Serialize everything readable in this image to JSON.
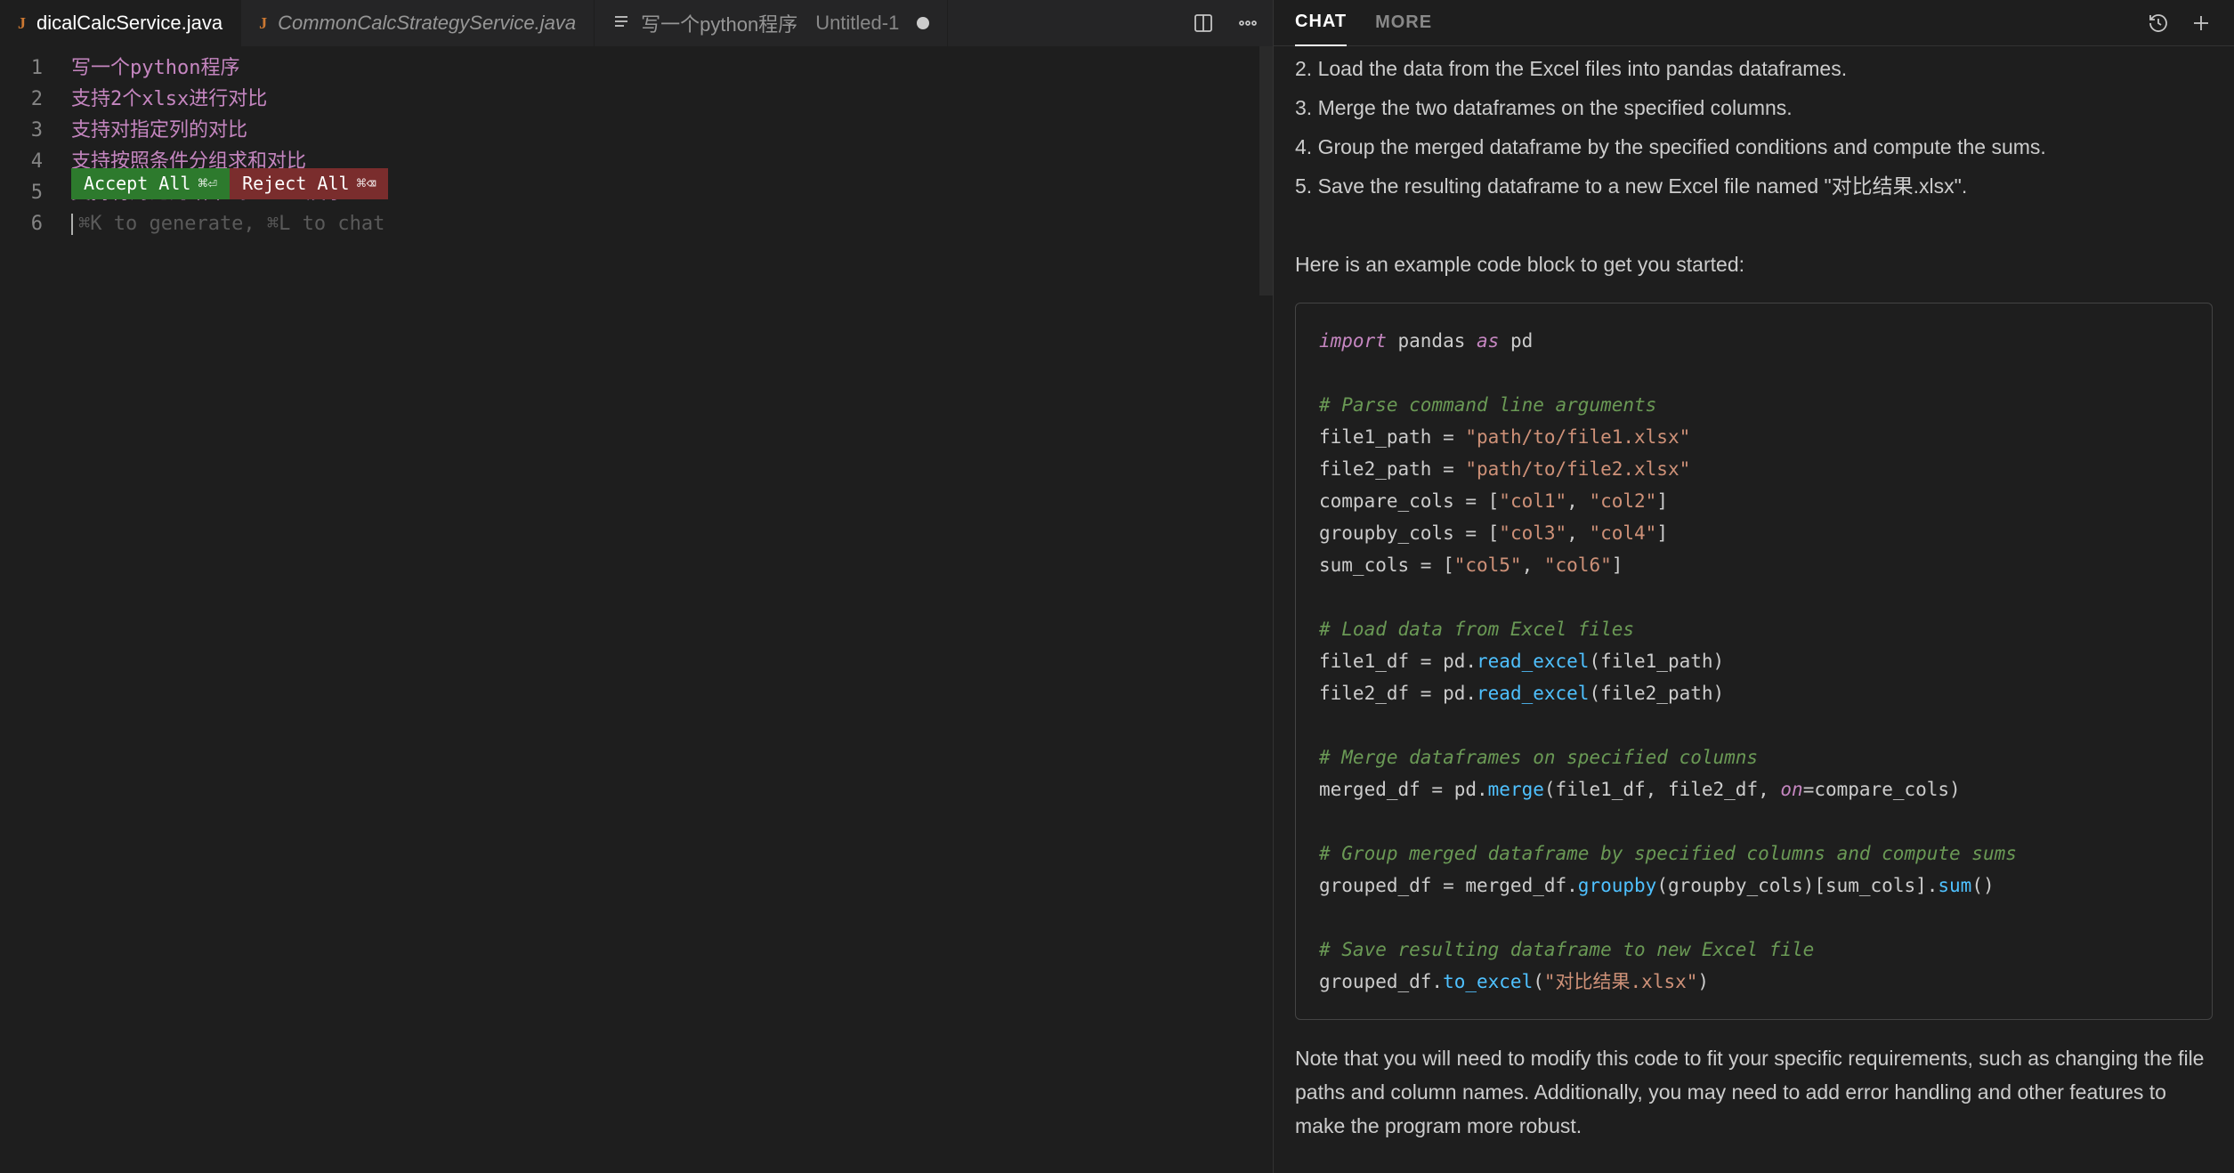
{
  "tabs": [
    {
      "icon": "J",
      "name": "dicalCalcService.java",
      "active": true
    },
    {
      "icon": "J",
      "name": "CommonCalcStrategyService.java",
      "italic": true
    },
    {
      "icon": "≡",
      "name": "写一个python程序",
      "untitled": "Untitled-1",
      "dirty": true
    }
  ],
  "editor": {
    "lines": [
      "写一个python程序",
      "支持2个xlsx进行对比",
      "支持对指定列的对比",
      "支持按照条件分组求和对比",
      "支持将对比的结果到excel展示"
    ],
    "hint": "⌘K to generate, ⌘L to chat",
    "accept_label": "Accept All",
    "accept_kb": "⌘⏎",
    "reject_label": "Reject All",
    "reject_kb": "⌘⌫"
  },
  "chat": {
    "tab_chat": "CHAT",
    "tab_more": "MORE",
    "pre_lines": [
      "2. Load the data from the Excel files into pandas dataframes.",
      "3. Merge the two dataframes on the specified columns.",
      "4. Group the merged dataframe by the specified conditions and compute the sums.",
      "5. Save the resulting dataframe to a new Excel file named \"对比结果.xlsx\"."
    ],
    "intro": "Here is an example code block to get you started:",
    "code": {
      "l01a": "import",
      "l01b": " pandas ",
      "l01c": "as",
      "l01d": " pd",
      "l03": "# Parse command line arguments",
      "l04a": "file1_path = ",
      "l04b": "\"path/to/file1.xlsx\"",
      "l05a": "file2_path = ",
      "l05b": "\"path/to/file2.xlsx\"",
      "l06a": "compare_cols = [",
      "l06b": "\"col1\"",
      "l06c": ", ",
      "l06d": "\"col2\"",
      "l06e": "]",
      "l07a": "groupby_cols = [",
      "l07b": "\"col3\"",
      "l07c": ", ",
      "l07d": "\"col4\"",
      "l07e": "]",
      "l08a": "sum_cols = [",
      "l08b": "\"col5\"",
      "l08c": ", ",
      "l08d": "\"col6\"",
      "l08e": "]",
      "l10": "# Load data from Excel files",
      "l11a": "file1_df = pd.",
      "l11b": "read_excel",
      "l11c": "(file1_path)",
      "l12a": "file2_df = pd.",
      "l12b": "read_excel",
      "l12c": "(file2_path)",
      "l14": "# Merge dataframes on specified columns",
      "l15a": "merged_df = pd.",
      "l15b": "merge",
      "l15c": "(file1_df, file2_df, ",
      "l15d": "on",
      "l15e": "=compare_cols)",
      "l17": "# Group merged dataframe by specified columns and compute sums",
      "l18a": "grouped_df = merged_df.",
      "l18b": "groupby",
      "l18c": "(groupby_cols)[sum_cols].",
      "l18d": "sum",
      "l18e": "()",
      "l20": "# Save resulting dataframe to new Excel file",
      "l21a": "grouped_df.",
      "l21b": "to_excel",
      "l21c": "(",
      "l21d": "\"对比结果.xlsx\"",
      "l21e": ")"
    },
    "note": "Note that you will need to modify this code to fit your specific requirements, such as changing the file paths and column names. Additionally, you may need to add error handling and other features to make the program more robust."
  }
}
